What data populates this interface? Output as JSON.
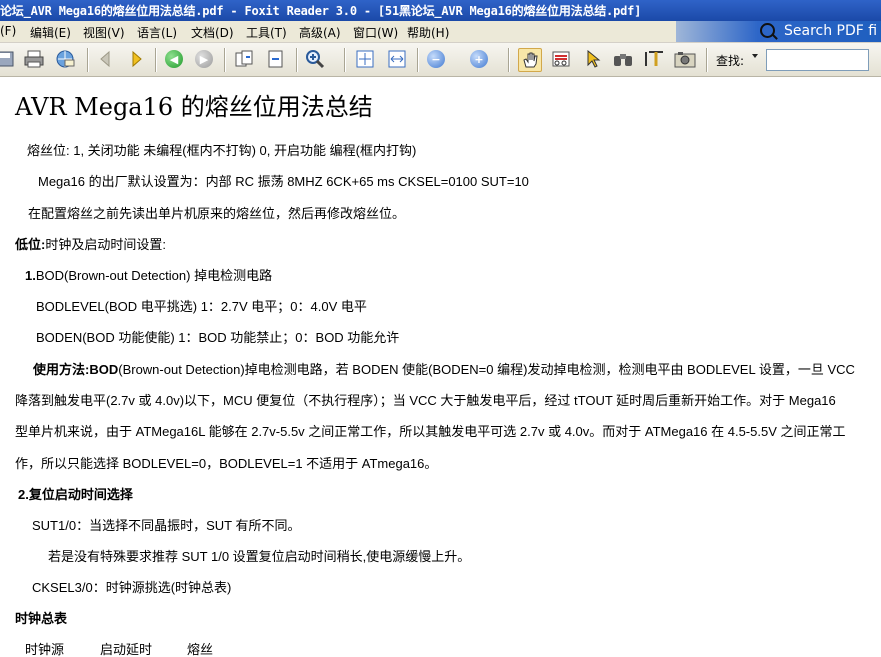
{
  "window": {
    "title": "论坛_AVR Mega16的熔丝位用法总结.pdf - Foxit Reader 3.0 - [51黑论坛_AVR Mega16的熔丝位用法总结.pdf]"
  },
  "search_ad": {
    "label": "Search PDF fi"
  },
  "menu": [
    "(F)",
    "编辑(E)",
    "视图(V)",
    "语言(L)",
    "文档(D)",
    "工具(T)",
    "高级(A)",
    "窗口(W)",
    "帮助(H)"
  ],
  "toolbar": {
    "find_label": "查找:",
    "find_value": ""
  },
  "document": {
    "title": "AVR Mega16 的熔丝位用法总结",
    "p1": "熔丝位: 1, 关闭功能  未编程(框内不打钩)        0, 开启功能  编程(框内打钩)",
    "p2": "Mega16 的出厂默认设置为：内部 RC 振荡 8MHZ 6CK+65 ms CKSEL=0100 SUT=10",
    "p3": "在配置熔丝之前先读出单片机原来的熔丝位，然后再修改熔丝位。",
    "low_label": "低位:",
    "low_text": "时钟及启动时间设置:",
    "bod_num": "1.",
    "bod_title": "BOD(Brown-out Detection) 掉电检测电路",
    "bodlevel": "BODLEVEL(BOD 电平挑选)  1：2.7V 电平；0：4.0V 电平",
    "boden": "BODEN(BOD 功能使能)          1：BOD 功能禁止；0：BOD 功能允许",
    "usage_label": "使用方法:",
    "usage_bod": "BOD",
    "usage_l1": "(Brown-out Detection)掉电检测电路，若 BODEN 使能(BODEN=0 编程)发动掉电检测，检测电平由 BODLEVEL 设置，一旦 VCC",
    "usage_l2": "降落到触发电平(2.7v 或 4.0v)以下，MCU 便复位（不执行程序）；当 VCC 大于触发电平后，经过 tTOUT 延时周后重新开始工作。对于 Mega16",
    "usage_l3": "型单片机来说，由于 ATMega16L 能够在 2.7v-5.5v 之间正常工作，所以其触发电平可选 2.7v 或 4.0v。而对于 ATMega16 在 4.5-5.5V 之间正常工",
    "usage_l4": "作，所以只能选择 BODLEVEL=0，BODLEVEL=1 不适用于 ATmega16。",
    "reset_title": "2.复位启动时间选择",
    "sut": "SUT1/0：当选择不同晶振时，SUT 有所不同。",
    "sut_note": "若是没有特殊要求推荐 SUT 1/0 设置复位启动时间稍长,使电源缓慢上升。",
    "cksel": "CKSEL3/0：时钟源挑选(时钟总表)",
    "clock_table_title": "时钟总表",
    "col1": "时钟源",
    "col2": "启动延时",
    "col3": "熔丝"
  }
}
